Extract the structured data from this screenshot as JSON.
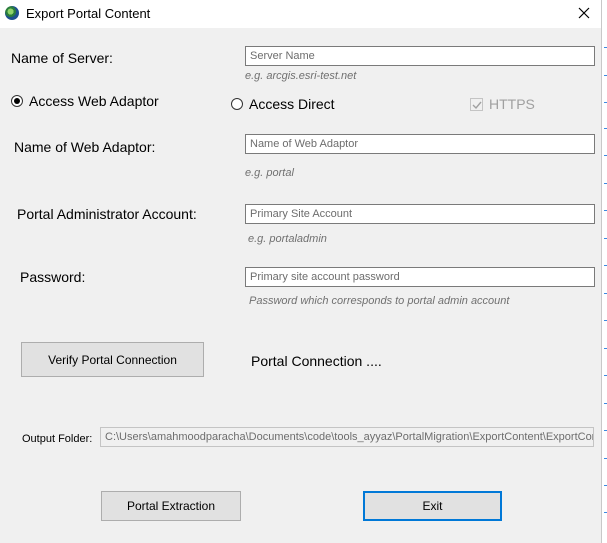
{
  "window": {
    "title": "Export Portal Content",
    "close_glyph": "close-icon"
  },
  "server": {
    "label": "Name of Server:",
    "placeholder": "Server Name",
    "hint": "e.g. arcgis.esri-test.net"
  },
  "connection_mode": {
    "options": [
      {
        "label": "Access Web Adaptor",
        "checked": true
      },
      {
        "label": "Access Direct",
        "checked": false
      }
    ],
    "https_label": "HTTPS",
    "https_checked": true
  },
  "web_adaptor": {
    "label": "Name of Web Adaptor:",
    "placeholder": "Name of Web Adaptor",
    "hint": "e.g. portal"
  },
  "admin_account": {
    "label": "Portal Administrator Account:",
    "placeholder": "Primary Site Account",
    "hint": "e.g. portaladmin"
  },
  "password": {
    "label": "Password:",
    "placeholder": "Primary site account password",
    "hint": "Password which corresponds to portal admin account"
  },
  "verify": {
    "button_label": "Verify Portal Connection",
    "status": "Portal Connection ...."
  },
  "output": {
    "label": "Output Folder:",
    "value": "C:\\Users\\amahmoodparacha\\Documents\\code\\tools_ayyaz\\PortalMigration\\ExportContent\\ExportContent"
  },
  "actions": {
    "extract_label": "Portal Extraction",
    "exit_label": "Exit"
  },
  "colors": {
    "background": "#f0f0f0",
    "accent": "#0078d7",
    "hint_text": "#707070"
  }
}
